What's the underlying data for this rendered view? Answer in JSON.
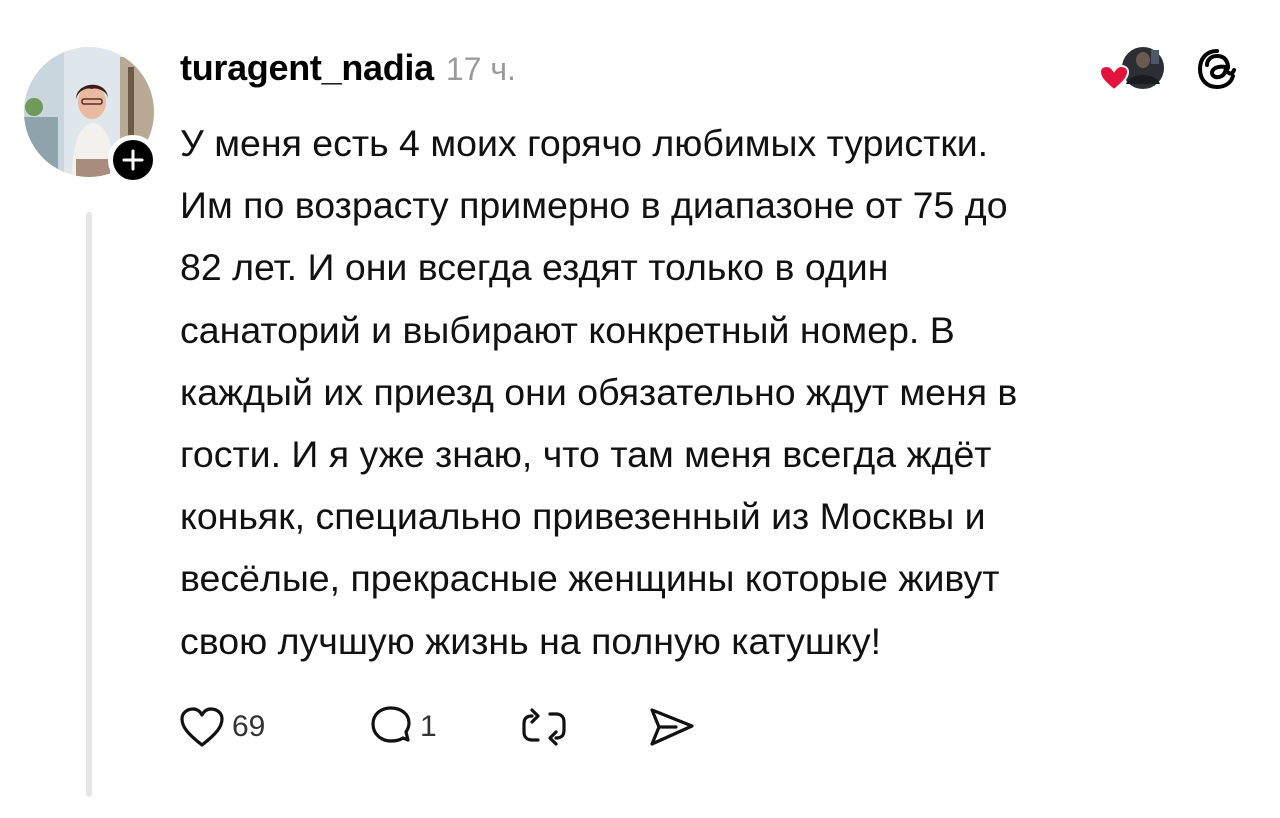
{
  "post": {
    "author": "turagent_nadia",
    "time": "17 ч.",
    "lines": [
      "У меня есть 4 моих горячо любимых туристки.",
      "Им по возрасту примерно в диапазоне от 75 до",
      "82 лет. И они всегда ездят только в один",
      "санаторий и  выбирают конкретный номер. В",
      "каждый их приезд они обязательно  ждут меня в",
      "гости. И я уже знаю, что там меня всегда ждёт",
      "коньяк, специально привезенный из Москвы и",
      "весёлые, прекрасные женщины которые живут",
      "свою лучшую жизнь на полную катушку!"
    ]
  },
  "actions": {
    "likes": "69",
    "replies": "1"
  },
  "icons": {
    "like": "heart-icon",
    "reply": "comment-bubble-icon",
    "repost": "repost-icon",
    "share": "send-icon",
    "app": "threads-logo-icon"
  },
  "colors": {
    "heart_badge": "#e3143b",
    "time_gray": "#9a9a9a",
    "thread_line": "#e6e6e6"
  }
}
